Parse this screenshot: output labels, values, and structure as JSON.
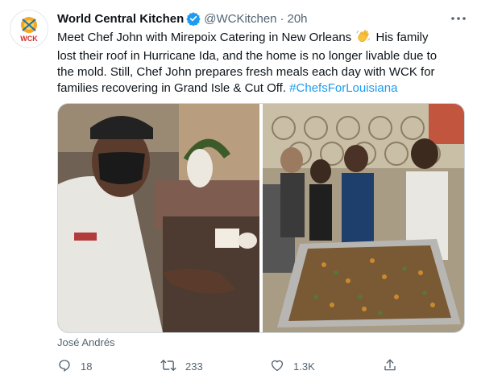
{
  "tweet": {
    "author_name": "World Central Kitchen",
    "handle": "@WCKitchen",
    "separator": "·",
    "time": "20h",
    "avatar_label": "WCK",
    "text_lines": [
      [
        "Meet Chef John with Mirepoix Catering in New Orleans ",
        " His family"
      ],
      "lost their roof in Hurricane Ida, and the home is no longer livable due to",
      "the mold. Still, Chef John prepares fresh meals each day with WCK for",
      "families recovering in Grand Isle & Cut Off. "
    ],
    "hashtag": "#ChefsForLouisiana",
    "photo_tag": "José Andrés"
  },
  "stats": {
    "replies": "18",
    "retweets": "233",
    "likes": "1.3K"
  },
  "icons": {
    "verified": "verified-badge-icon",
    "more": "more-icon",
    "reply": "reply-icon",
    "retweet": "retweet-icon",
    "like": "heart-icon",
    "share": "share-icon",
    "wave": "waving-hand-emoji"
  },
  "colors": {
    "link": "#1d9bf0",
    "muted": "#536471",
    "text": "#0f1419",
    "verified": "#1d9bf0"
  }
}
